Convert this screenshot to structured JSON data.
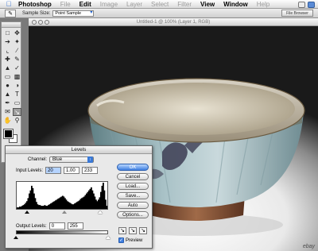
{
  "menubar": {
    "app": "Photoshop",
    "items": [
      "File",
      "Edit",
      "Image",
      "Layer",
      "Select",
      "Filter",
      "View",
      "Window",
      "Help"
    ],
    "enabled": [
      false,
      true,
      false,
      false,
      false,
      false,
      true,
      true,
      false
    ]
  },
  "options": {
    "sample_size_label": "Sample Size:",
    "sample_size_value": "Point Sample",
    "palette_well": "File Browser"
  },
  "document": {
    "title": "Untitled-1 @ 100% (Layer 1, RGB)"
  },
  "levels": {
    "title": "Levels",
    "channel_label": "Channel:",
    "channel_value": "Blue",
    "input_label": "Input Levels:",
    "input_black": "20",
    "input_gamma": "1.00",
    "input_white": "233",
    "output_label": "Output Levels:",
    "output_black": "0",
    "output_white": "255",
    "buttons": {
      "ok": "OK",
      "cancel": "Cancel",
      "load": "Load...",
      "save": "Save...",
      "auto": "Auto",
      "options": "Options..."
    },
    "preview_label": "Preview",
    "preview_checked": true,
    "histogram": [
      2,
      2,
      3,
      3,
      4,
      5,
      6,
      8,
      10,
      14,
      20,
      24,
      30,
      27,
      20,
      14,
      9,
      6,
      5,
      5,
      4,
      4,
      4,
      5,
      4,
      4,
      5,
      6,
      7,
      8,
      9,
      10,
      11,
      12,
      13,
      14,
      15,
      16,
      17,
      16,
      14,
      12,
      10,
      9,
      8,
      7,
      6,
      6,
      7,
      8,
      9,
      10,
      11,
      13,
      14,
      15,
      16,
      18,
      20,
      22,
      24,
      26,
      28,
      24,
      20,
      16,
      12,
      10,
      12,
      15,
      22,
      30,
      34,
      24,
      12,
      4
    ]
  },
  "watermark": "ebay"
}
